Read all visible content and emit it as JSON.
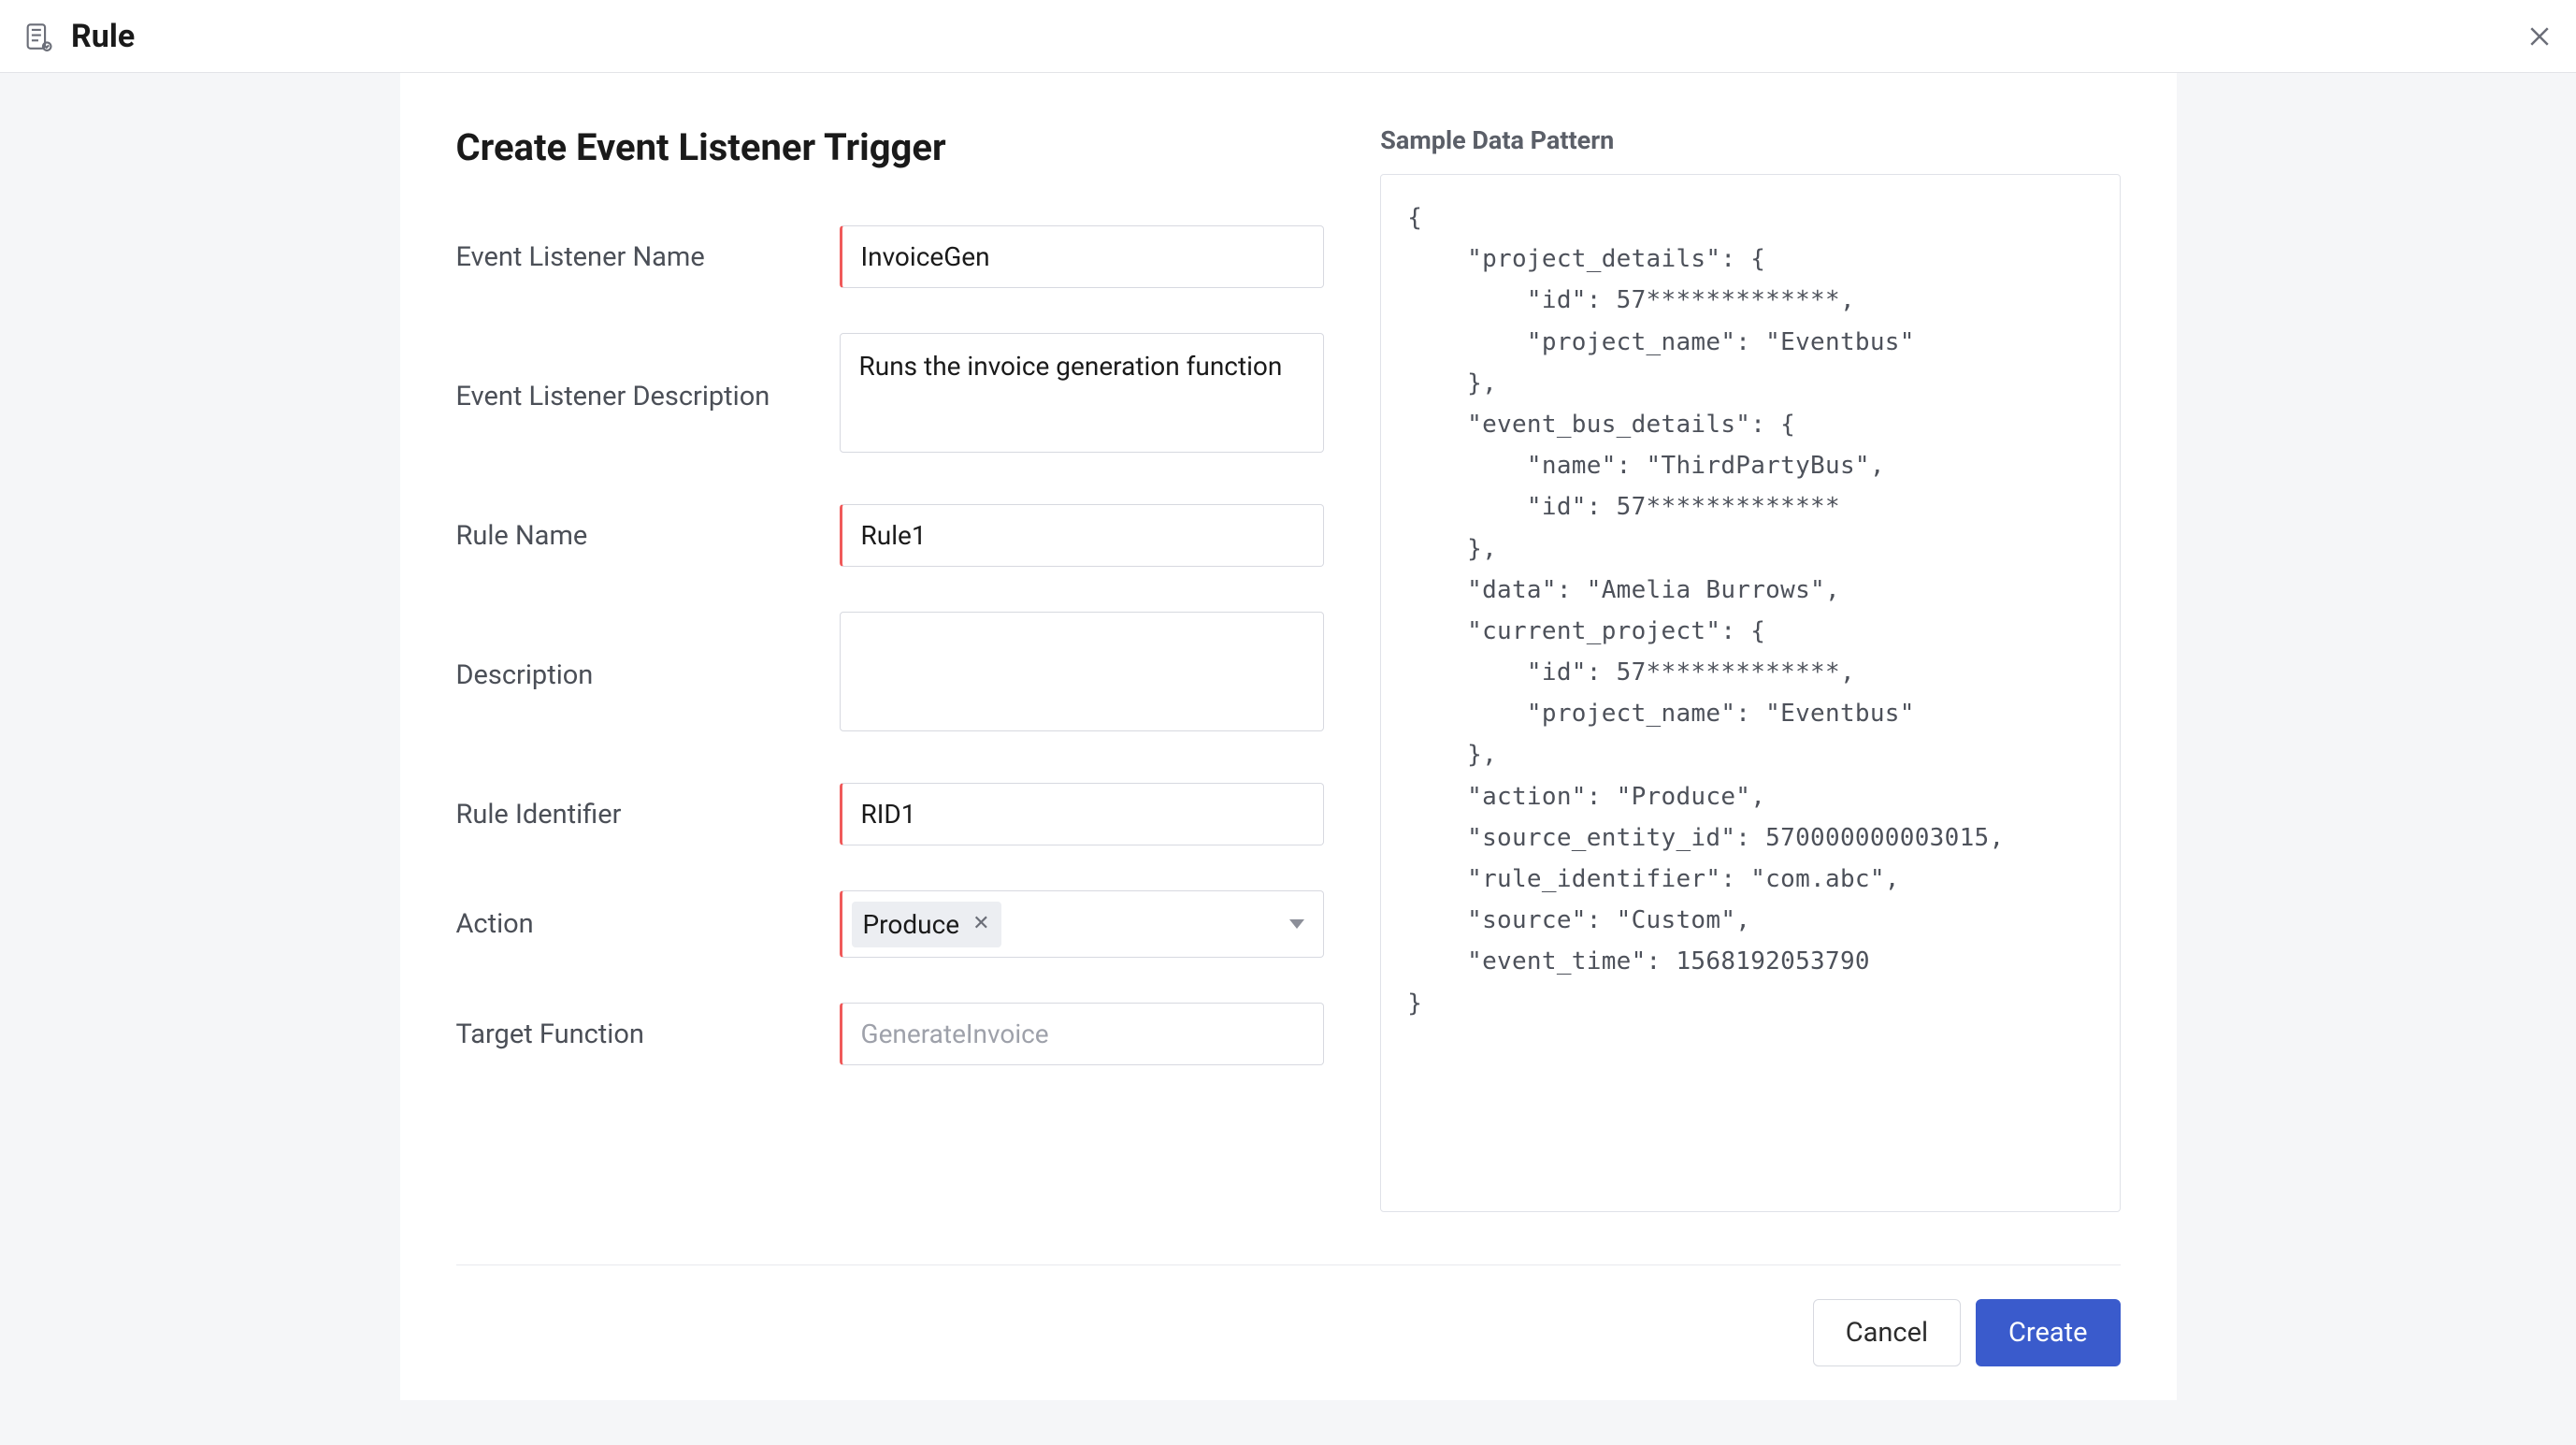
{
  "header": {
    "title": "Rule"
  },
  "form": {
    "title": "Create Event Listener Trigger",
    "labels": {
      "event_listener_name": "Event Listener Name",
      "event_listener_description": "Event Listener Description",
      "rule_name": "Rule Name",
      "description": "Description",
      "rule_identifier": "Rule Identifier",
      "action": "Action",
      "target_function": "Target Function"
    },
    "values": {
      "event_listener_name": "InvoiceGen",
      "event_listener_description": "Runs the invoice generation function",
      "rule_name": "Rule1",
      "description": "",
      "rule_identifier": "RID1",
      "action_chip": "Produce",
      "target_function_placeholder": "GenerateInvoice"
    }
  },
  "sample": {
    "title": "Sample Data Pattern",
    "json_text": "{\n    \"project_details\": {\n        \"id\": 57*************,\n        \"project_name\": \"Eventbus\"\n    },\n    \"event_bus_details\": {\n        \"name\": \"ThirdPartyBus\",\n        \"id\": 57*************\n    },\n    \"data\": \"Amelia Burrows\",\n    \"current_project\": {\n        \"id\": 57*************,\n        \"project_name\": \"Eventbus\"\n    },\n    \"action\": \"Produce\",\n    \"source_entity_id\": 570000000003015,\n    \"rule_identifier\": \"com.abc\",\n    \"source\": \"Custom\",\n    \"event_time\": 1568192053790\n}"
  },
  "footer": {
    "cancel": "Cancel",
    "create": "Create"
  }
}
